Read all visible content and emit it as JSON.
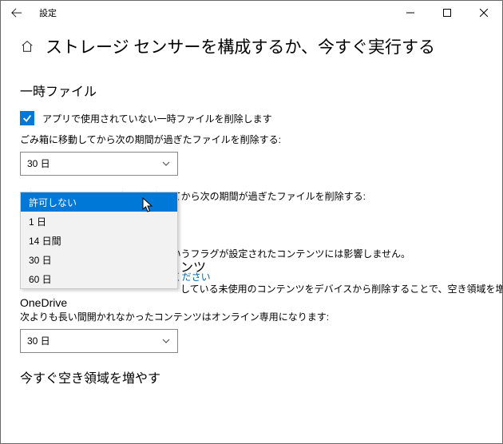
{
  "titlebar": {
    "title": "設定"
  },
  "page_title": "ストレージ センサーを構成するか、今すぐ実行する",
  "sections": {
    "temp_files": {
      "heading": "一時ファイル",
      "checkbox_label": "アプリで使用されていない一時ファイルを削除します",
      "recycle_label": "ごみ箱に移動してから次の期間が過ぎたファイルを削除する:",
      "recycle_value": "30 日",
      "downloads_label": "[ダウンロード] フォルダーに保存してから次の期間が過ぎたファイルを削除する:",
      "downloads_options": [
        "許可しない",
        "1 日",
        "14 日間",
        "30 日",
        "60 日"
      ],
      "downloads_selected_index": 0
    },
    "cloud": {
      "heading_partial": "ンツ",
      "body_partial": "している未使用のコンテンツをデバイスから削除することで、空き領域を増やすことができま",
      "flag_note": "[このデバイス上に常に保持する] というフラグが設定されたコンテンツには影響しません。",
      "link": "詳細についてはここをクリックしてください",
      "onedrive_heading": "OneDrive",
      "onedrive_label": "次よりも長い間開かれなかったコンテンツはオンライン専用になります:",
      "onedrive_value": "30 日"
    },
    "free_now": {
      "heading": "今すぐ空き領域を増やす"
    }
  }
}
